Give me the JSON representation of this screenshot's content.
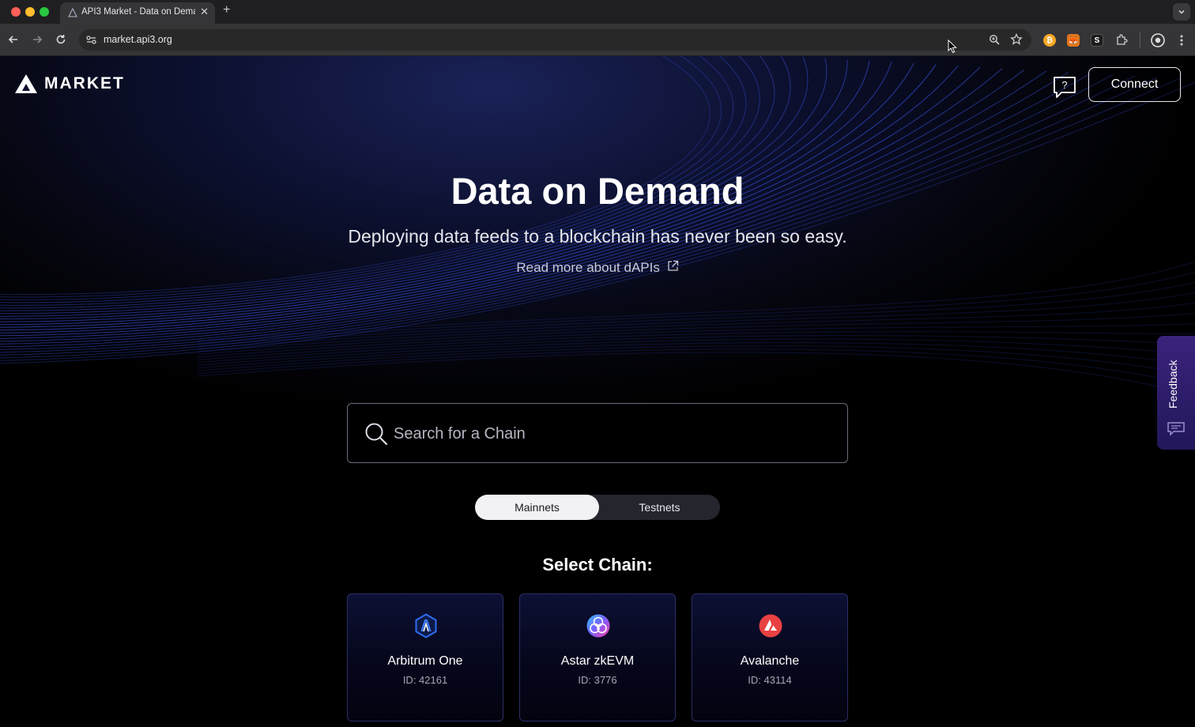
{
  "browser": {
    "tab_title": "API3 Market - Data on Demand",
    "url": "market.api3.org",
    "new_tab_symbol": "+",
    "close_symbol": "✕"
  },
  "header": {
    "logo_text": "MARKET",
    "help_label": "?",
    "connect_label": "Connect"
  },
  "hero": {
    "title": "Data on Demand",
    "subtitle": "Deploying data feeds to a blockchain has never been so easy.",
    "link_label": "Read more about dAPIs"
  },
  "search": {
    "placeholder": "Search for a Chain",
    "value": ""
  },
  "network_toggle": {
    "options": [
      {
        "label": "Mainnets",
        "selected": true
      },
      {
        "label": "Testnets",
        "selected": false
      }
    ]
  },
  "chains": {
    "heading": "Select Chain:",
    "items": [
      {
        "name": "Arbitrum One",
        "id": "ID: 42161",
        "icon": "arbitrum-icon"
      },
      {
        "name": "Astar zkEVM",
        "id": "ID: 3776",
        "icon": "astar-icon"
      },
      {
        "name": "Avalanche",
        "id": "ID: 43114",
        "icon": "avalanche-icon"
      }
    ]
  },
  "feedback": {
    "label": "Feedback"
  },
  "colors": {
    "background": "#000000",
    "accent_blue": "#2b3cc9",
    "feedback_purple": "#3b237c",
    "avalanche_red": "#e84142"
  }
}
